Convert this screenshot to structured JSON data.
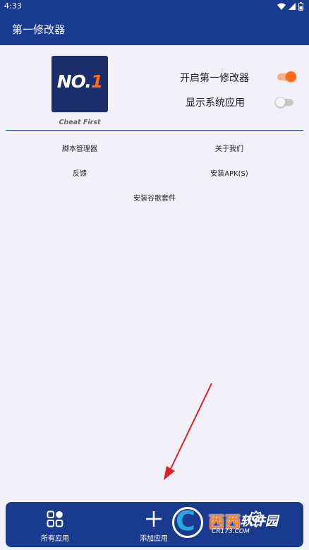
{
  "status_bar": {
    "time": "4:33",
    "icons": [
      "wifi-icon",
      "signal-icon",
      "battery-icon"
    ]
  },
  "app_bar": {
    "title": "第一修改器"
  },
  "logo": {
    "text_main": "NO.",
    "text_accent": "1",
    "caption": "Cheat First",
    "bg_color": "#1b2e6b",
    "accent_color": "#ff6a13"
  },
  "toggles": [
    {
      "label": "开启第一修改器",
      "on": true
    },
    {
      "label": "显示系统应用",
      "on": false
    }
  ],
  "menu": {
    "script_manager": "脚本管理器",
    "about_us": "关于我们",
    "feedback": "反馈",
    "install_apk": "安装APK(S)",
    "install_google": "安装谷歌套件"
  },
  "bottom_nav": {
    "items": [
      {
        "label": "所有应用",
        "icon": "apps-grid-icon"
      },
      {
        "label": "添加应用",
        "icon": "plus-icon"
      },
      {
        "label": "",
        "icon": "gear-icon"
      }
    ]
  },
  "watermark": {
    "letter": "C",
    "brand": "西西",
    "brand2": "软件园",
    "domain": "CR173.COM"
  },
  "colors": {
    "primary": "#1a3a8f",
    "accent": "#ff6a13",
    "background": "#f2f0f8"
  }
}
